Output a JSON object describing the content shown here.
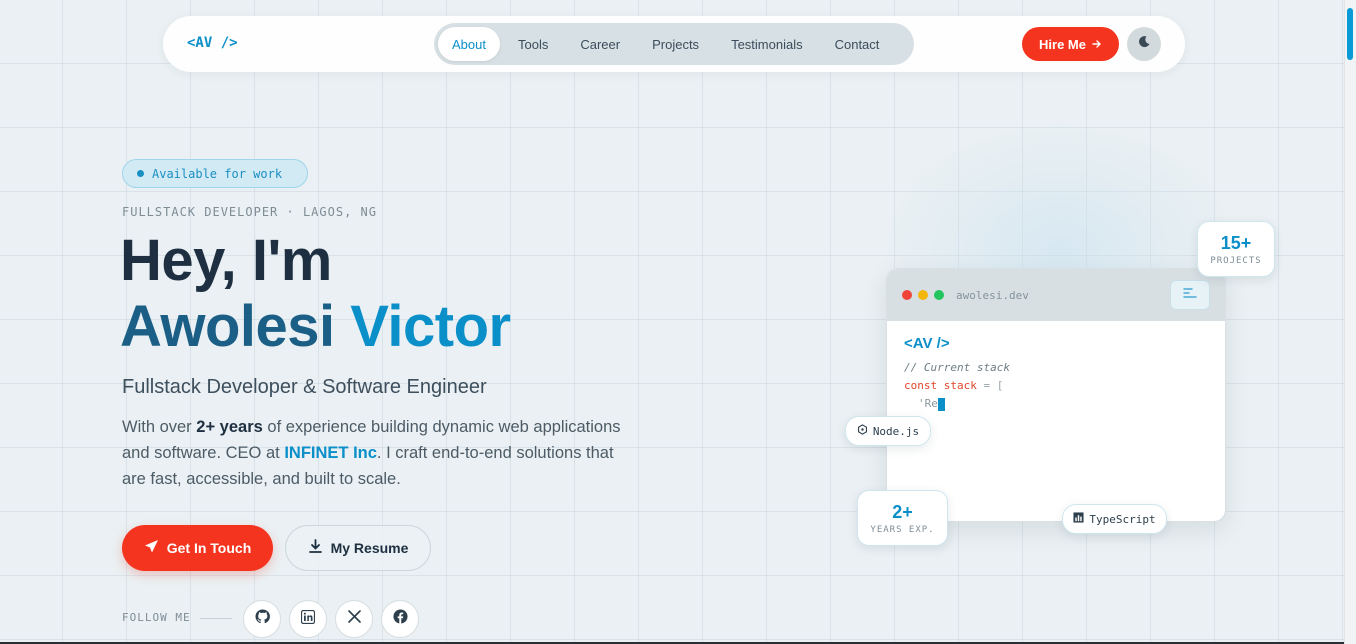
{
  "nav": {
    "logo": "<AV />",
    "items": [
      {
        "label": "About",
        "active": true
      },
      {
        "label": "Tools",
        "active": false
      },
      {
        "label": "Career",
        "active": false
      },
      {
        "label": "Projects",
        "active": false
      },
      {
        "label": "Testimonials",
        "active": false
      },
      {
        "label": "Contact",
        "active": false
      }
    ],
    "hire_label": "Hire Me",
    "hire_icon": "arrow-right-icon",
    "theme_icon": "moon-icon"
  },
  "hero": {
    "badge": "Available for work",
    "eyebrow": "FULLSTACK DEVELOPER · LAGOS, NG",
    "greeting": "Hey, I'm",
    "name_first": "Awolesi",
    "name_last": "Victor",
    "subtitle": "Fullstack Developer & Software Engineer",
    "desc_1": "With over ",
    "desc_years": "2+ years",
    "desc_2": " of experience building dynamic web applications and software. CEO at ",
    "desc_company": "INFINET Inc",
    "desc_3": ". I craft end-to-end solutions that are fast, accessible, and built to scale.",
    "cta_label": "Get In Touch",
    "cta_icon": "send-icon",
    "resume_label": "My Resume",
    "resume_icon": "download-icon",
    "follow_label": "FOLLOW ME",
    "socials": [
      "github-icon",
      "linkedin-icon",
      "x-icon",
      "facebook-icon"
    ]
  },
  "code_window": {
    "url": "awolesi.dev",
    "logo": "<AV />",
    "comment": "// Current stack",
    "line_kw": "const stack",
    "line_op": " = [",
    "line_str": "'Re"
  },
  "stats": {
    "projects_num": "15+",
    "projects_label": "PROJECTS",
    "years_num": "2+",
    "years_label": "YEARS EXP."
  },
  "chips": {
    "node": "Node.js",
    "typescript": "TypeScript"
  },
  "colors": {
    "accent": "#0a8fc9",
    "cta": "#f5341f",
    "dark": "#1d2f40"
  }
}
